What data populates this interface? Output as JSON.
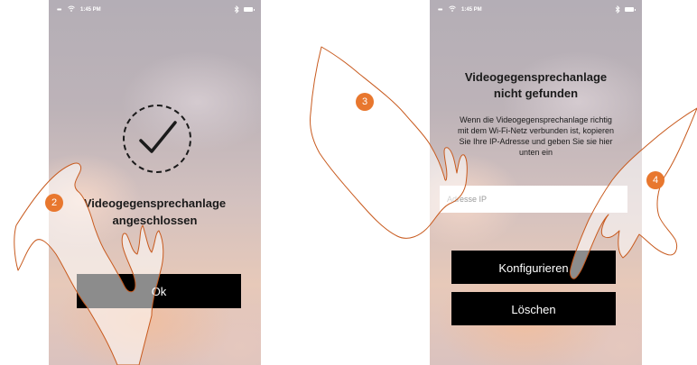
{
  "screens": [
    {
      "status_time": "1:45 PM",
      "title_line1": "Videogegensprechanlage",
      "title_line2": "angeschlossen",
      "ok_label": "Ok"
    },
    {
      "status_time": "1:45 PM",
      "title_line1": "Videogegensprechanlage",
      "title_line2": "nicht gefunden",
      "desc_lines": [
        "Wenn die Videogegensprechanlage richtig",
        "mit dem Wi-Fi-Netz verbunden ist, kopieren",
        "Sie Ihre IP-Adresse und geben Sie sie hier",
        "unten ein"
      ],
      "ip_placeholder": "Adresse IP",
      "configure_label": "Konfigurieren",
      "delete_label": "Löschen"
    }
  ],
  "step_badges": [
    "2",
    "3",
    "4"
  ],
  "colors": {
    "badge": "#e8772e",
    "button": "#000000",
    "hand_outline": "#c85a1e"
  },
  "icons": [
    "wifi-icon",
    "bluetooth-icon",
    "battery-icon",
    "checkmark-icon",
    "pointing-hand-icon"
  ]
}
